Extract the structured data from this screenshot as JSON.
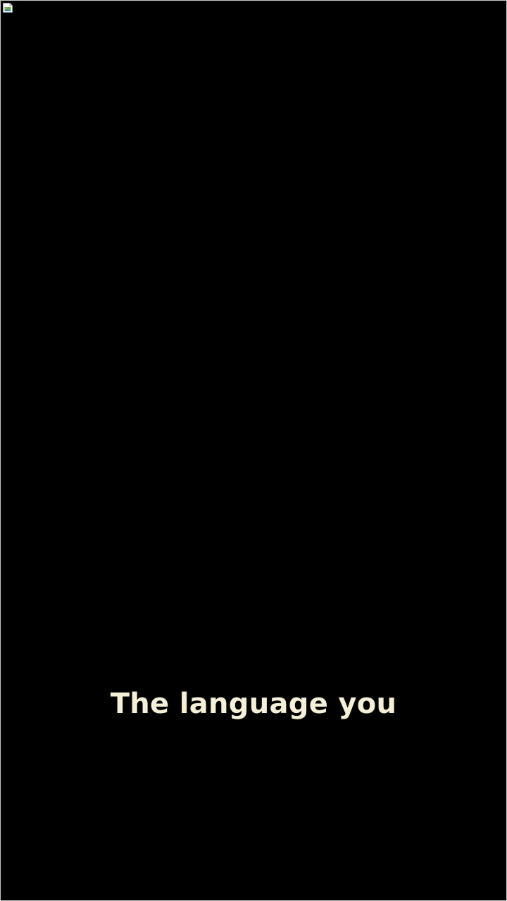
{
  "media": {
    "broken_image_icon": "broken-image-icon",
    "caption": "The language you"
  },
  "colors": {
    "background": "#000000",
    "caption_text": "#f4efd5",
    "frame_border": "#c9c9c9"
  }
}
